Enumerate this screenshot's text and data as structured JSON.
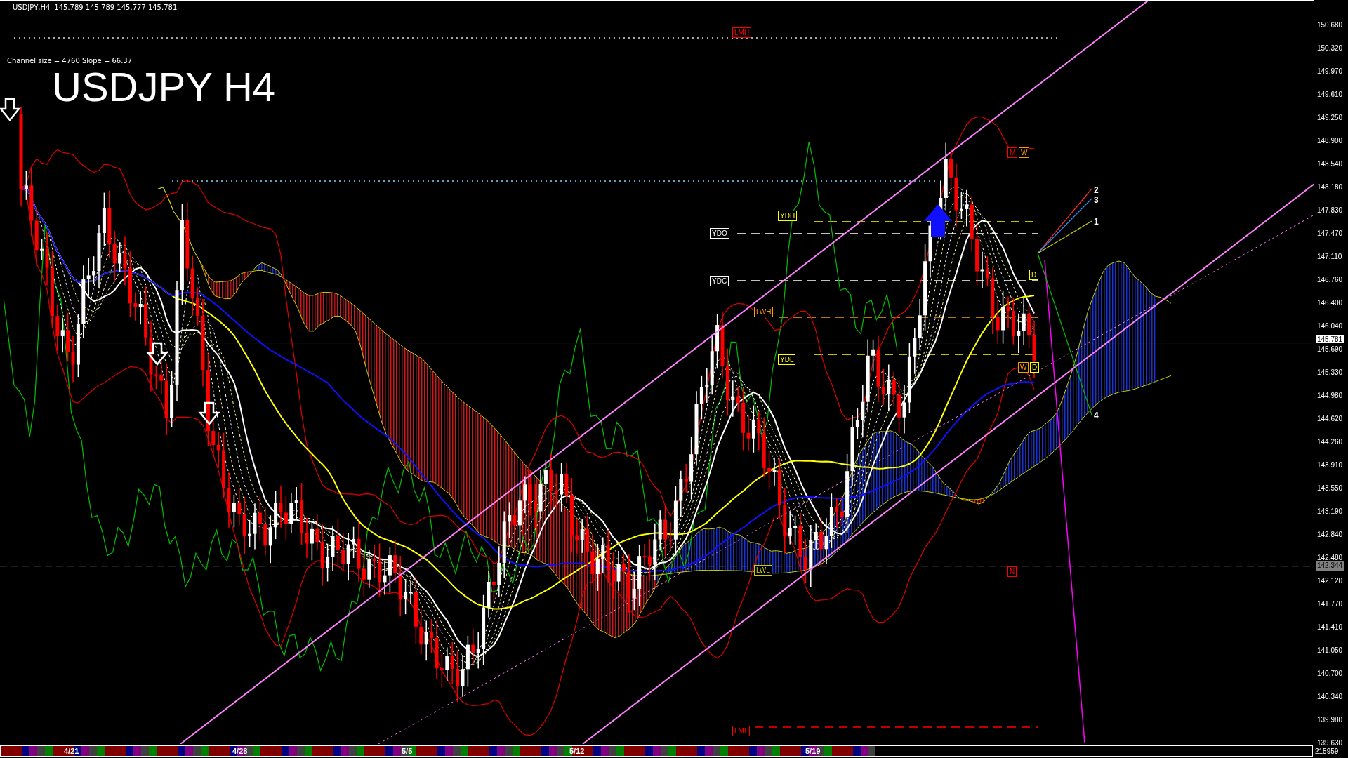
{
  "header": {
    "symbol": "USDJPY,H4",
    "prices": "145.789 145.789 145.777 145.781"
  },
  "channel_info": "Channel size = 4760 Slope = 66.37",
  "chart_title": "USDJPY H4",
  "level_labels": [
    {
      "text": "LMH",
      "color": "#ff0000"
    },
    {
      "text": "M",
      "color": "#ff0000"
    },
    {
      "text": "W",
      "color": "#ff9900"
    },
    {
      "text": "YDH",
      "color": "#ffff00"
    },
    {
      "text": "YDO",
      "color": "#ffffff"
    },
    {
      "text": "YDC",
      "color": "#ffffff"
    },
    {
      "text": "D",
      "color": "#ffff00"
    },
    {
      "text": "LWH",
      "color": "#ff9900"
    },
    {
      "text": "YDL",
      "color": "#ffff00"
    },
    {
      "text": "W",
      "color": "#ff9900"
    },
    {
      "text": "D",
      "color": "#ffff00"
    },
    {
      "text": "LWL",
      "color": "#cccc00"
    },
    {
      "text": "N",
      "color": "#ff0000"
    },
    {
      "text": "LML",
      "color": "#ff0000"
    }
  ],
  "line_numbers": [
    "2",
    "3",
    "1",
    "4"
  ],
  "price_axis": {
    "labels": [
      "150.680",
      "150.320",
      "149.970",
      "149.610",
      "149.250",
      "148.900",
      "148.540",
      "148.180",
      "147.830",
      "147.470",
      "147.110",
      "146.760",
      "146.400",
      "146.040",
      "145.690",
      "145.330",
      "144.980",
      "144.620",
      "144.260",
      "143.910",
      "143.550",
      "143.190",
      "142.840",
      "142.480",
      "142.120",
      "141.770",
      "141.410",
      "141.050",
      "140.700",
      "140.340",
      "139.980",
      "139.630"
    ],
    "bid": "145.781",
    "marker": "142.344"
  },
  "time_axis": {
    "labels": [
      "4/21",
      "4/28",
      "5/5",
      "5/12",
      "5/19"
    ]
  },
  "corner": "215959"
}
